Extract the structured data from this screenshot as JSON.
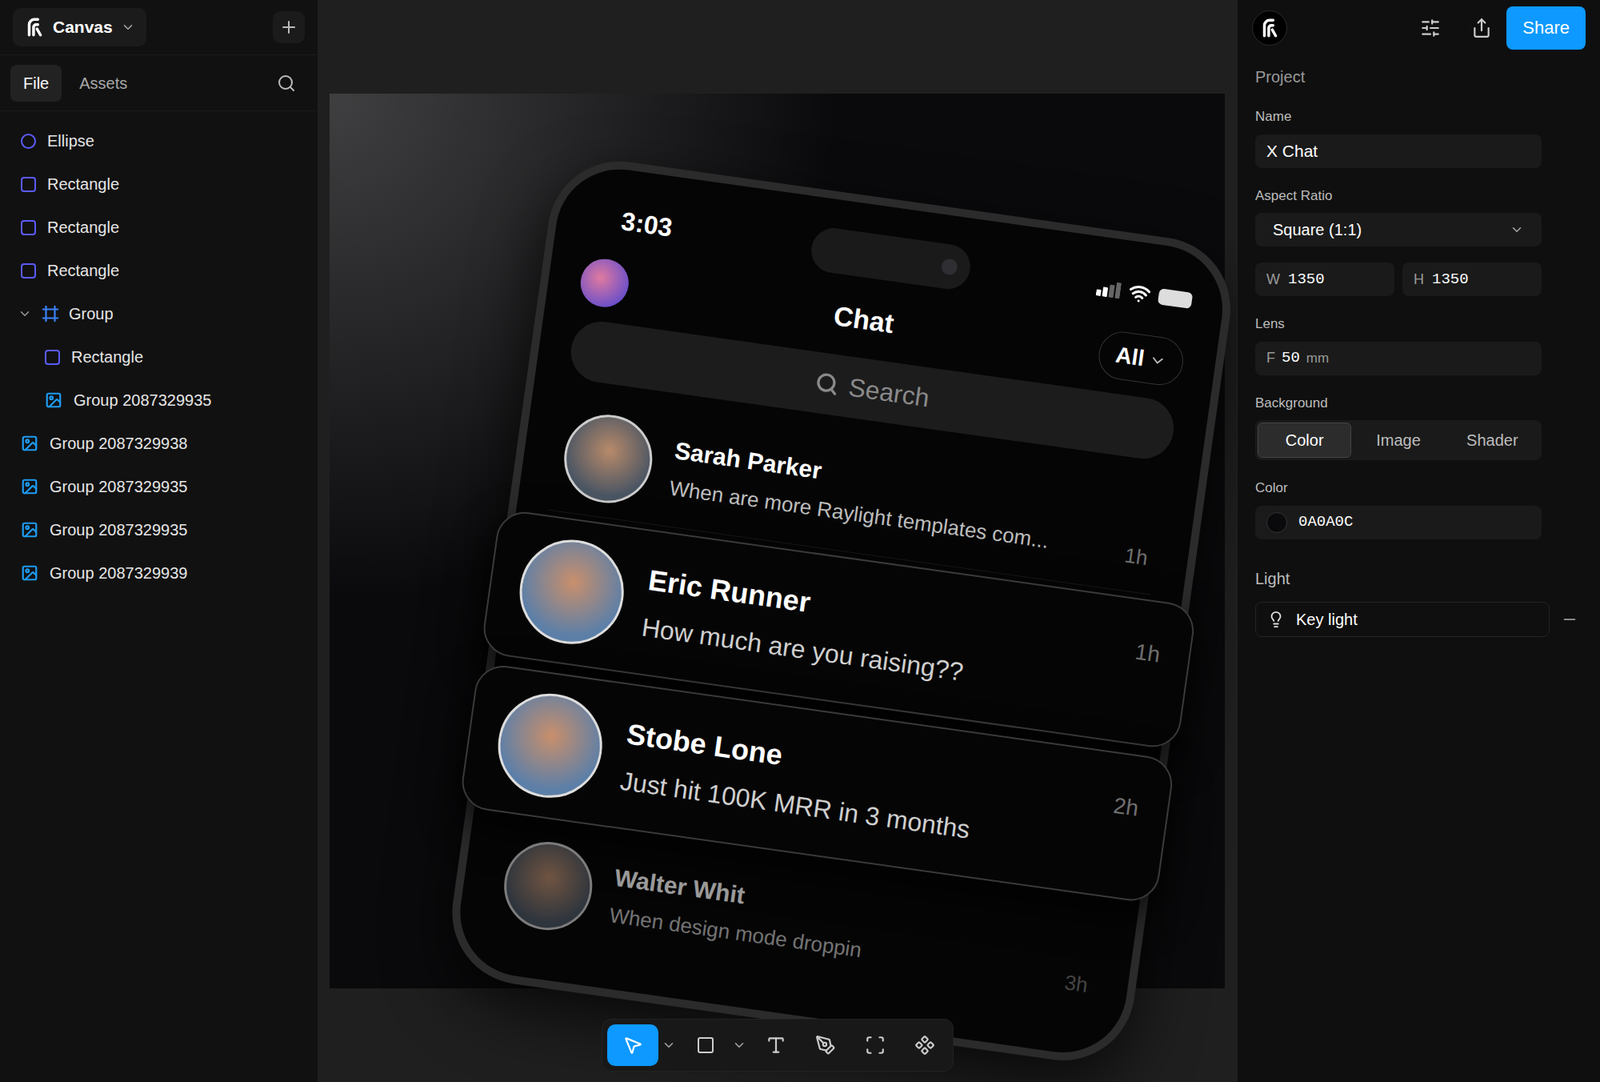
{
  "app": {
    "name": "Canvas"
  },
  "sidebar": {
    "tabs": [
      {
        "label": "File",
        "selected": true
      },
      {
        "label": "Assets",
        "selected": false
      }
    ],
    "layers": [
      {
        "label": "Ellipse",
        "kind": "ellipse",
        "depth": 0
      },
      {
        "label": "Rectangle",
        "kind": "rectangle",
        "depth": 0
      },
      {
        "label": "Rectangle",
        "kind": "rectangle",
        "depth": 0
      },
      {
        "label": "Rectangle",
        "kind": "rectangle",
        "depth": 0
      },
      {
        "label": "Group",
        "kind": "group",
        "depth": 0,
        "expanded": true
      },
      {
        "label": "Rectangle",
        "kind": "rectangle",
        "depth": 1
      },
      {
        "label": "Group 2087329935",
        "kind": "image",
        "depth": 1
      },
      {
        "label": "Group 2087329938",
        "kind": "image",
        "depth": 0
      },
      {
        "label": "Group 2087329935",
        "kind": "image",
        "depth": 0
      },
      {
        "label": "Group 2087329935",
        "kind": "image",
        "depth": 0
      },
      {
        "label": "Group 2087329939",
        "kind": "image",
        "depth": 0
      }
    ]
  },
  "canvas": {
    "phone": {
      "time": "3:03",
      "title": "Chat",
      "filter": "All",
      "search_placeholder": "Search",
      "chats": [
        {
          "name": "Sarah Parker",
          "message": "When are more Raylight templates com...",
          "time": "1h",
          "highlighted": false,
          "dimmed": false
        },
        {
          "name": "Eric Runner",
          "message": "How much are you raising??",
          "time": "1h",
          "highlighted": true,
          "dimmed": false
        },
        {
          "name": "Stobe Lone",
          "message": "Just hit 100K MRR in 3 months",
          "time": "2h",
          "highlighted": true,
          "dimmed": false
        },
        {
          "name": "Walter Whit",
          "message": "When design mode droppin",
          "time": "3h",
          "highlighted": false,
          "dimmed": true
        }
      ]
    }
  },
  "toolbar": {
    "tools": [
      {
        "kind": "select",
        "selected": true,
        "has_menu": true
      },
      {
        "kind": "rectangle",
        "selected": false,
        "has_menu": true
      },
      {
        "kind": "text",
        "selected": false,
        "has_menu": false
      },
      {
        "kind": "pen",
        "selected": false,
        "has_menu": false
      },
      {
        "kind": "frame",
        "selected": false,
        "has_menu": false
      },
      {
        "kind": "components",
        "selected": false,
        "has_menu": false
      }
    ]
  },
  "inspector": {
    "share_button": "Share",
    "section": "Project",
    "name": {
      "label": "Name",
      "value": "X Chat"
    },
    "aspect_ratio": {
      "label": "Aspect Ratio",
      "value": "Square (1:1)"
    },
    "width": {
      "label": "W",
      "value": "1350"
    },
    "height": {
      "label": "H",
      "value": "1350"
    },
    "lens": {
      "label": "Lens",
      "prefix": "F",
      "value": "50",
      "unit": "mm"
    },
    "background": {
      "label": "Background",
      "options": [
        {
          "label": "Color",
          "selected": true
        },
        {
          "label": "Image",
          "selected": false
        },
        {
          "label": "Shader",
          "selected": false
        }
      ]
    },
    "color": {
      "label": "Color",
      "value": "0A0A0C"
    },
    "light": {
      "label": "Light",
      "items": [
        {
          "label": "Key light"
        }
      ]
    }
  }
}
